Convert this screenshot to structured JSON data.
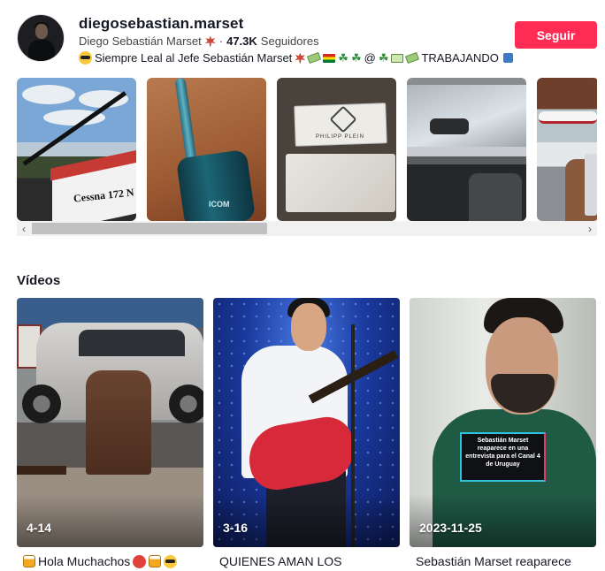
{
  "profile": {
    "username": "diegosebastian.marset",
    "display_name": "Diego Sebastián Marset",
    "separator": "·",
    "followers_count": "47.3K",
    "followers_label": "Seguidores",
    "bio_text_1": "Siempre Leal al Jefe Sebastián Marset",
    "bio_text_2": "@",
    "bio_text_3": "TRABAJANDO",
    "follow_label": "Seguir",
    "accent_color": "#fe2c55"
  },
  "stories": [
    {
      "name": "story-cessna",
      "caption": "Cessna 172 N"
    },
    {
      "name": "story-radio",
      "caption": "ICOM"
    },
    {
      "name": "story-packages",
      "caption": "PHILIPP PLEIN"
    },
    {
      "name": "story-car-interior",
      "caption": ""
    },
    {
      "name": "story-hangar",
      "caption": ""
    }
  ],
  "videos_section": {
    "title": "Vídeos",
    "items": [
      {
        "date": "4-14",
        "title": "Hola Muchachos"
      },
      {
        "date": "3-16",
        "title": "QUIENES AMAN LOS"
      },
      {
        "date": "2023-11-25",
        "title": "Sebastián Marset reaparece",
        "overlay_text": "Sebastián Marset reaparece en una entrevista para el Canal 4 de Uruguay"
      }
    ]
  },
  "icons": {
    "scroll_left": "chevron-left-icon",
    "scroll_right": "chevron-right-icon"
  }
}
